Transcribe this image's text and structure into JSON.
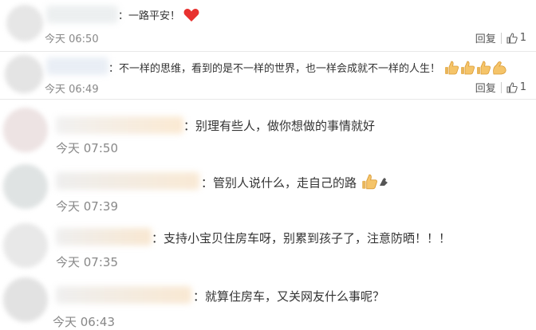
{
  "comments": [
    {
      "prefix": "：",
      "text": "一路平安！",
      "time": "今天 06:50",
      "reply": "回复",
      "likes": "1"
    },
    {
      "prefix": "：",
      "text": "不一样的思维，看到的是不一样的世界，也一样会成就不一样的人生！",
      "time": "今天 06:49",
      "reply": "回复",
      "likes": "1"
    },
    {
      "prefix": "：",
      "text": "别理有些人，做你想做的事情就好",
      "time": "今天 07:50"
    },
    {
      "prefix": "：",
      "text": "管别人说什么，走自己的路",
      "time": "今天 07:39"
    },
    {
      "prefix": "：",
      "text": "支持小宝贝住房车呀，别累到孩子了，注意防晒！！！",
      "time": "今天 07:35"
    },
    {
      "prefix": "：",
      "text": "就算住房车，又关网友什么事呢？",
      "time": "今天 06:43"
    }
  ],
  "icons": {
    "heart": "heart-icon",
    "thumbs": "thumbs-up-icon",
    "strong": "flexed-biceps-icon",
    "writing": "writing-hand-icon",
    "like": "like-icon"
  },
  "colors": {
    "heart": "#e8312f",
    "thumb_fill": "#f5c469",
    "time": "#888888",
    "divider": "#e8e8e8"
  }
}
